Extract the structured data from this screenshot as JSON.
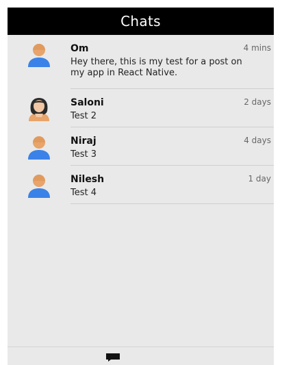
{
  "header": {
    "title": "Chats"
  },
  "chats": [
    {
      "name": "Om",
      "time": "4 mins",
      "message_lines": [
        "Hey there, this is my test for a post on",
        "my app in React Native."
      ],
      "avatar": "male-avatar-icon"
    },
    {
      "name": "Saloni",
      "time": "2 days",
      "message": "Test 2",
      "avatar": "female-avatar-icon"
    },
    {
      "name": "Niraj",
      "time": "4 days",
      "message": "Test 3",
      "avatar": "male-avatar-icon"
    },
    {
      "name": "Nilesh",
      "time": "1 day",
      "message": "Test 4",
      "avatar": "male-avatar-icon"
    }
  ],
  "footer": {
    "tab_icon": "chat-bubble-icon"
  },
  "colors": {
    "header_bg": "#000000",
    "body_bg": "#e9e9e9",
    "avatar_skin": "#e8a46a",
    "avatar_shirt": "#3b82e8"
  }
}
